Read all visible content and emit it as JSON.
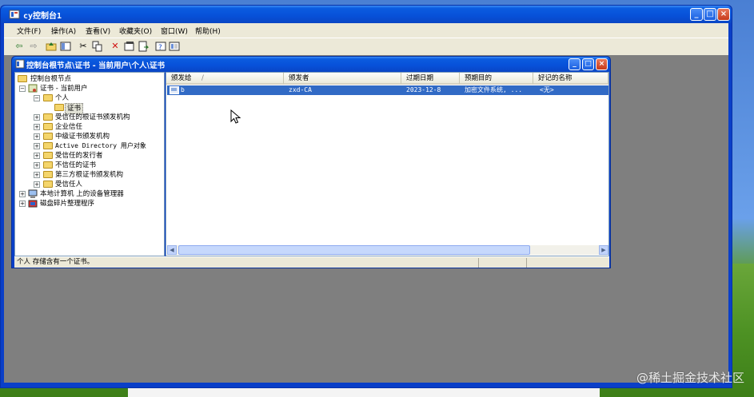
{
  "window": {
    "title": "cy控制台1",
    "minimize": "_",
    "maximize": "□",
    "close": "×"
  },
  "menu": [
    {
      "label": "文件(F)"
    },
    {
      "label": "操作(A)"
    },
    {
      "label": "查看(V)"
    },
    {
      "label": "收藏夹(O)"
    },
    {
      "label": "窗口(W)"
    },
    {
      "label": "帮助(H)"
    }
  ],
  "toolbar": {
    "icons": [
      "back-arrow-icon",
      "forward-arrow-icon",
      "up-folder-icon",
      "show-hide-tree-icon",
      "cut-icon",
      "copy-icon",
      "delete-icon",
      "properties-icon",
      "export-list-icon",
      "help-icon",
      "help-topics-icon"
    ]
  },
  "child_window": {
    "title": "控制台根节点\\证书 - 当前用户\\个人\\证书"
  },
  "tree": {
    "root": "控制台根节点",
    "certs_current_user": "证书 - 当前用户",
    "personal": "个人",
    "certificates": "证书",
    "trusted_root": "受信任的根证书颁发机构",
    "enterprise_trust": "企业信任",
    "intermediate": "中级证书颁发机构",
    "ad_user_object": "Active Directory 用户对象",
    "trusted_publishers": "受信任的发行者",
    "untrusted": "不信任的证书",
    "third_party_root": "第三方根证书颁发机构",
    "trusted_people": "受信任人",
    "device_manager": "本地计算机 上的设备管理器",
    "defrag": "磁盘碎片整理程序"
  },
  "list": {
    "columns": [
      "颁发给",
      "颁发者",
      "过期日期",
      "预期目的",
      "好记的名称"
    ],
    "sort_indicator": "/",
    "rows": [
      {
        "issued_to": "b",
        "issued_by": "zxd-CA",
        "expiry": "2023-12-8",
        "purpose": "加密文件系统, ...",
        "friendly": "<无>"
      }
    ]
  },
  "statusbar": {
    "text": "个人 存储含有一个证书。"
  },
  "watermark": "@稀土掘金技术社区"
}
